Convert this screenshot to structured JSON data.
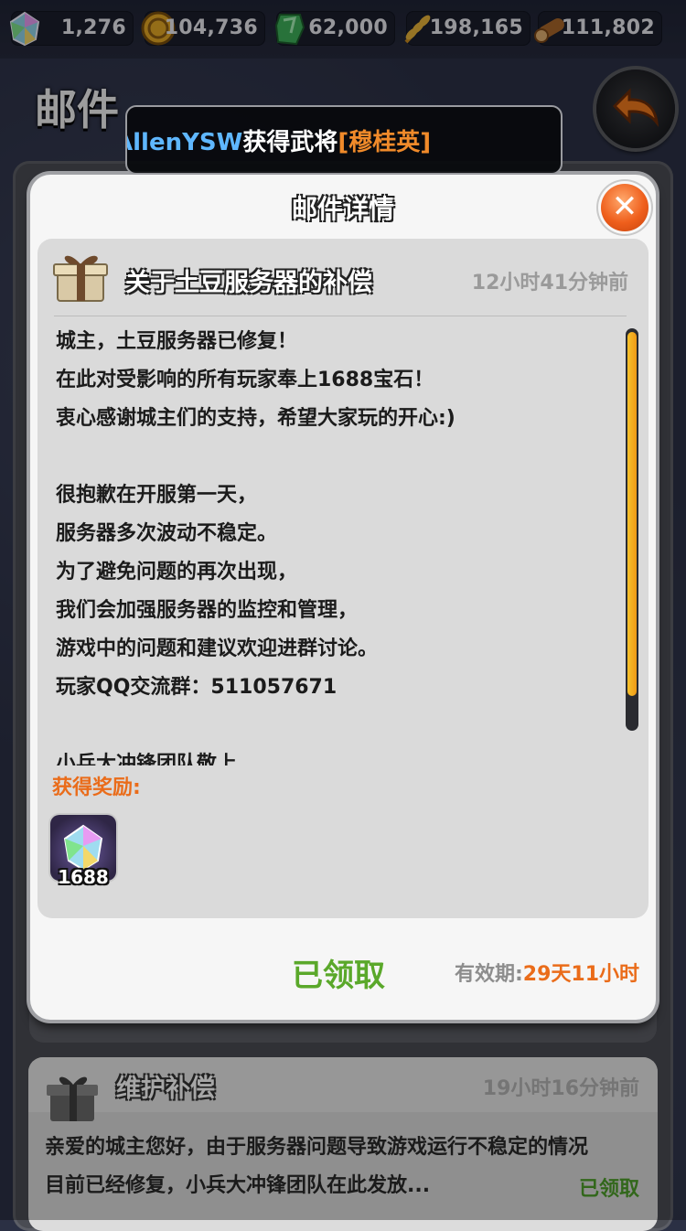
{
  "resources": [
    {
      "icon": "gem-icon",
      "value": "1,276"
    },
    {
      "icon": "gold-coin-icon",
      "value": "104,736"
    },
    {
      "icon": "jade-icon",
      "value": "62,000"
    },
    {
      "icon": "wheat-icon",
      "value": "198,165"
    },
    {
      "icon": "wood-icon",
      "value": "111,802"
    }
  ],
  "page": {
    "title": "邮件"
  },
  "banner": {
    "player": "AllenYSW",
    "action": "获得武将",
    "hero": "[穆桂英]"
  },
  "modal": {
    "title": "邮件详情",
    "close_label": "✕",
    "subject": "关于土豆服务器的补偿",
    "time": "12小时41分钟前",
    "body_lines": [
      "城主，土豆服务器已修复！",
      "在此对受影响的所有玩家奉上1688宝石！",
      "衷心感谢城主们的支持，希望大家玩的开心:)",
      "",
      "很抱歉在开服第一天，",
      "服务器多次波动不稳定。",
      "为了避免问题的再次出现，",
      "我们会加强服务器的监控和管理，",
      "游戏中的问题和建议欢迎进群讨论。",
      "玩家QQ交流群：511057671",
      "",
      "小兵大冲锋团队敬上"
    ],
    "reward_label": "获得奖励:",
    "reward": {
      "icon": "gem-icon",
      "qty": "1688"
    },
    "claimed_label": "已领取",
    "expiry_label": "有效期:",
    "expiry_value": "29天11小时"
  },
  "mail_list": [
    {
      "subject": "维护补偿",
      "time": "19小时16分钟前",
      "preview_1": "亲爱的城主您好，由于服务器问题导致游戏运行不稳定的情况",
      "preview_2": "目前已经修复，小兵大冲锋团队在此发放...",
      "status": "已领取"
    }
  ]
}
